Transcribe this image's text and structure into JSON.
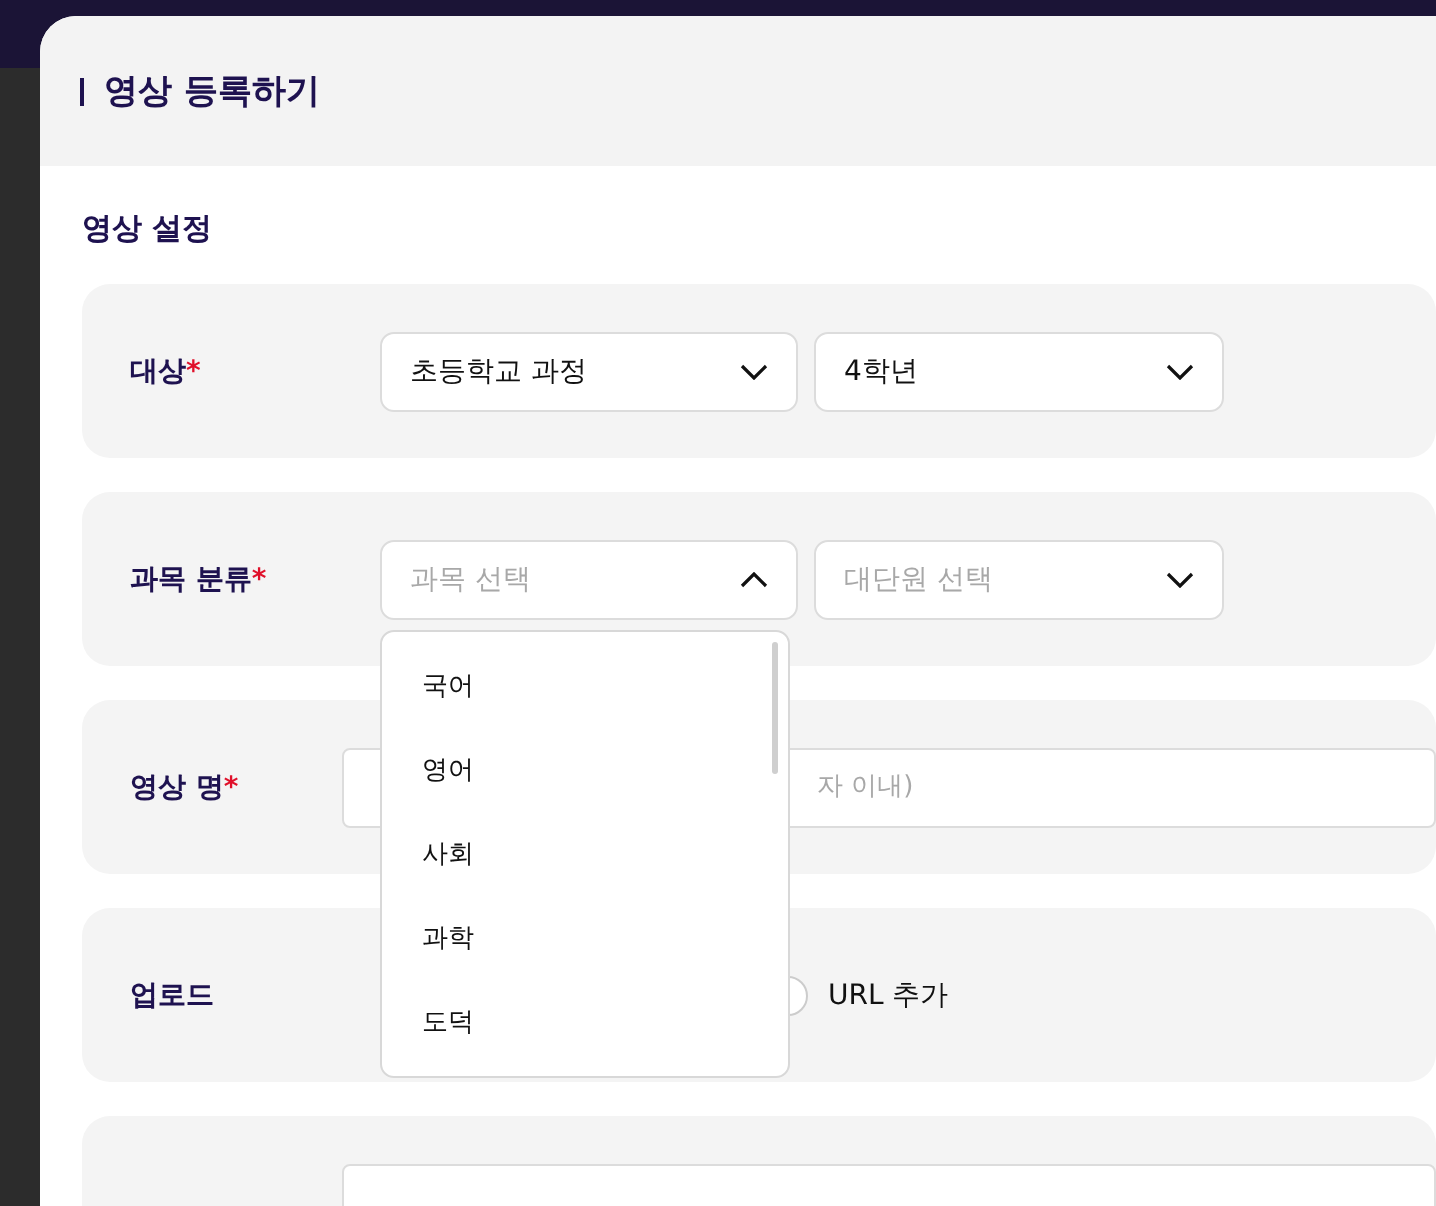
{
  "modal": {
    "title": "영상 등록하기"
  },
  "section": {
    "title": "영상 설정"
  },
  "fields": [
    {
      "kind": "selects",
      "label": "대상",
      "required_mark": "*",
      "selects": [
        {
          "value": "초등학교 과정",
          "expanded": false
        },
        {
          "value": "4학년",
          "expanded": false
        }
      ]
    },
    {
      "kind": "selects",
      "label": "과목 분류",
      "required_mark": "*",
      "selects": [
        {
          "placeholder": "과목 선택",
          "expanded": true,
          "options": [
            "국어",
            "영어",
            "사회",
            "과학",
            "도덕"
          ]
        },
        {
          "placeholder": "대단원 선택",
          "expanded": false
        }
      ]
    },
    {
      "kind": "text",
      "label": "영상 명",
      "required_mark": "*",
      "placeholder": "자 이내)"
    },
    {
      "kind": "radio",
      "label": "업로드",
      "options": [
        {
          "label": "URL 추가",
          "checked": false
        }
      ]
    },
    {
      "kind": "text"
    }
  ]
}
